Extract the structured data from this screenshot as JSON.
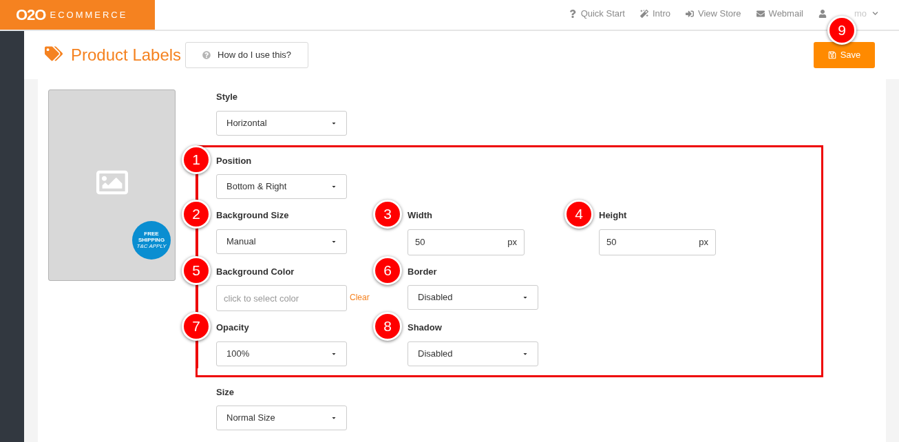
{
  "brand": {
    "mark": "O2O",
    "name": "ECOMMERCE"
  },
  "top_nav": [
    {
      "kind": "help",
      "label": "Quick Start"
    },
    {
      "kind": "wand",
      "label": "Intro"
    },
    {
      "kind": "signin",
      "label": "View Store"
    },
    {
      "kind": "mail",
      "label": "Webmail"
    },
    {
      "kind": "user",
      "label": "mo"
    }
  ],
  "header": {
    "title": "Product Labels",
    "help_button": "How do I use this?",
    "save_button": "Save",
    "save_badge": "9"
  },
  "preview": {
    "sticker": [
      "FREE",
      "SHIPPING",
      "T&C APPLY"
    ]
  },
  "style_field": {
    "kind": "select",
    "label": "Style",
    "value": "Horizontal"
  },
  "highlighted_rows": [
    [
      {
        "kind": "select",
        "badge": "1",
        "label": "Position",
        "value": "Bottom & Right"
      }
    ],
    [
      {
        "kind": "select",
        "badge": "2",
        "label": "Background Size",
        "value": "Manual"
      },
      {
        "kind": "unit",
        "badge": "3",
        "label": "Width",
        "value": "50",
        "unit": "px"
      },
      {
        "kind": "unit",
        "badge": "4",
        "label": "Height",
        "value": "50",
        "unit": "px"
      }
    ],
    [
      {
        "kind": "color",
        "badge": "5",
        "label": "Background Color",
        "placeholder": "click to select color",
        "action": "Clear"
      },
      {
        "kind": "select",
        "badge": "6",
        "label": "Border",
        "value": "Disabled"
      }
    ],
    [
      {
        "kind": "select",
        "badge": "7",
        "label": "Opacity",
        "value": "100%"
      },
      {
        "kind": "select",
        "badge": "8",
        "label": "Shadow",
        "value": "Disabled"
      }
    ]
  ],
  "size_field": {
    "kind": "select",
    "label": "Size",
    "value": "Normal Size"
  }
}
